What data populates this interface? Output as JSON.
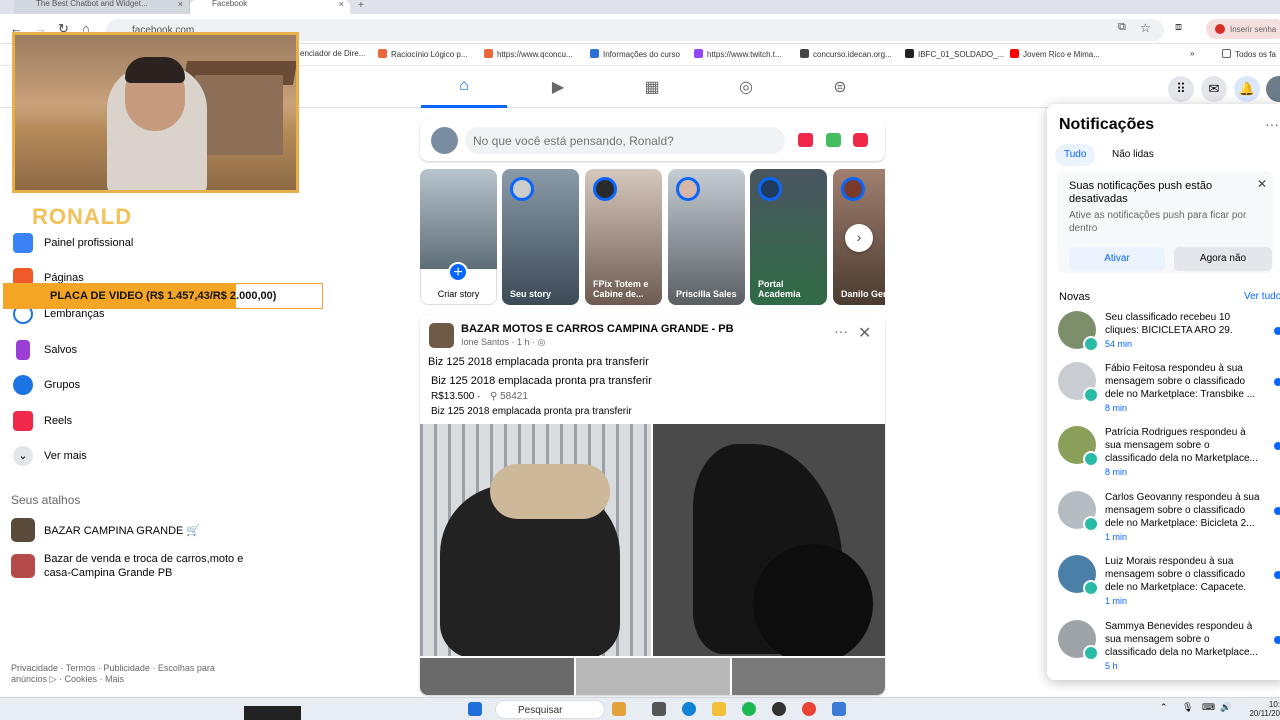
{
  "browser": {
    "tabs": [
      {
        "title": "The Best Chatbot and Widget..."
      },
      {
        "title": "Facebook"
      }
    ],
    "url": "facebook.com",
    "password_prompt": "Inserir senha",
    "bookmarks": [
      "enciador de Dire...",
      "Raciocínio Lógico p...",
      "https://www.qconcu...",
      "Informações do curso",
      "https://www.twitch.t...",
      "concurso.idecan.org...",
      "IBFC_01_SOLDADO_...",
      "Jovem Rico e Mima...",
      "Todos os fa"
    ]
  },
  "stream": {
    "streamer_name": "RONALD",
    "donation_goal": "PLACA DE VIDEO (R$ 1.457,43/R$ 2.000,00)",
    "donation_fraction": 0.7287
  },
  "left_nav": {
    "items": [
      {
        "label": "Painel profissional"
      },
      {
        "label": "Páginas"
      },
      {
        "label": "Lembranças"
      },
      {
        "label": "Salvos"
      },
      {
        "label": "Grupos"
      },
      {
        "label": "Reels"
      },
      {
        "label": "Ver mais"
      }
    ],
    "shortcuts_title": "Seus atalhos",
    "shortcuts": [
      {
        "label": "BAZAR CAMPINA GRANDE 🛒"
      },
      {
        "label": "Bazar de venda e troca de carros,moto e casa-Campina Grande PB"
      }
    ],
    "footer": "Privacidade · Termos · Publicidade · Escolhas para anúncios ▷ · Cookies · Mais"
  },
  "composer": {
    "placeholder": "No que você está pensando, Ronald?"
  },
  "stories": [
    {
      "name": "Criar story"
    },
    {
      "name": "Seu story"
    },
    {
      "name": "FPix Totem e Cabine de..."
    },
    {
      "name": "Priscilla Sales"
    },
    {
      "name": "Portal Academia"
    },
    {
      "name": "Danilo Gen"
    }
  ],
  "post": {
    "group": "BAZAR MOTOS E CARROS CAMPINA GRANDE - PB",
    "author_meta": "Ione Santos · 1 h · ◎",
    "text_top": "Biz 125 2018 emplacada pronta pra transferir",
    "item_title": "Biz 125 2018 emplacada pronta pra transferir",
    "price": "R$13.500 ·",
    "location": "58421",
    "description": "Biz 125 2018 emplacada pronta pra transferir"
  },
  "notifications": {
    "title": "Notificações",
    "filter_all": "Tudo",
    "filter_unread": "Não lidas",
    "push_title": "Suas notificações push estão desativadas",
    "push_sub": "Ative as notificações push para ficar por dentro",
    "push_enable": "Ativar",
    "push_later": "Agora não",
    "section": "Novas",
    "see_all": "Ver tudo",
    "items": [
      {
        "text": "Seu classificado recebeu 10 cliques: BICICLETA ARO 29.",
        "time": "54 min"
      },
      {
        "text": "Fábio Feitosa respondeu à sua mensagem sobre o classificado dele no Marketplace: Transbike ...",
        "time": "8 min"
      },
      {
        "text": "Patrícia Rodrigues respondeu à sua mensagem sobre o classificado dela no Marketplace...",
        "time": "8 min"
      },
      {
        "text": "Carlos Geovanny respondeu à sua mensagem sobre o classificado dele no Marketplace: Bicicleta 2...",
        "time": "1 min"
      },
      {
        "text": "Luiz Morais respondeu à sua mensagem sobre o classificado dele no Marketplace: Capacete.",
        "time": "1 min"
      },
      {
        "text": "Sammya Benevides respondeu à sua mensagem sobre o classificado dela no Marketplace...",
        "time": "5 h"
      }
    ]
  },
  "taskbar": {
    "search": "Pesquisar",
    "time": "10:",
    "date": "20/11/20"
  }
}
